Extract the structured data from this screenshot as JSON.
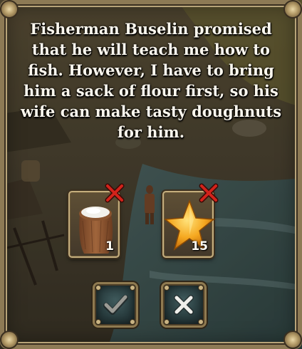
{
  "dialog": {
    "message": "Fisherman Buselin promised that he will teach me how to fish. However, I have to bring him a sack of flour first, so his wife can make tasty doughnuts for him."
  },
  "requirements": [
    {
      "item": "flour sack",
      "icon": "flour-sack-icon",
      "quantity": "1",
      "fulfilled": false
    },
    {
      "item": "star",
      "icon": "star-icon",
      "quantity": "15",
      "fulfilled": false
    }
  ],
  "actions": {
    "confirm_icon": "checkmark-icon",
    "cancel_icon": "close-icon"
  },
  "colors": {
    "text": "#fbf7ee",
    "unmet_marker": "#d2231b",
    "frame": "#8d7a55",
    "button_face": "#2f4547"
  }
}
